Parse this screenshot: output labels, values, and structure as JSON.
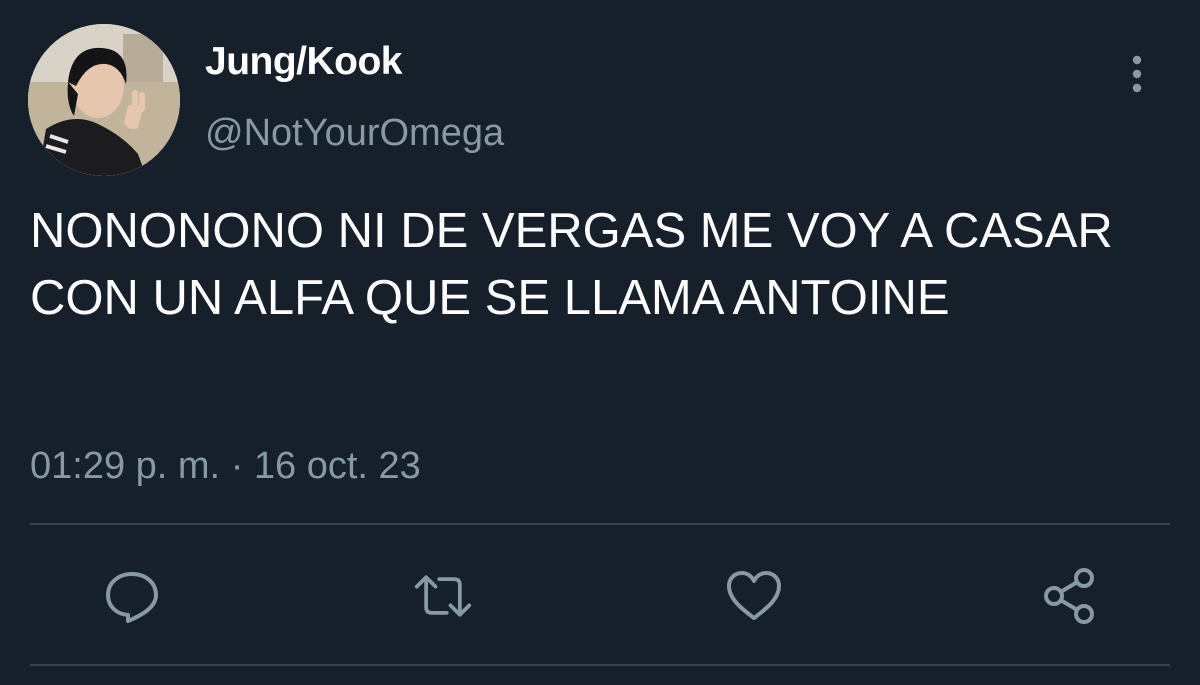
{
  "user": {
    "display_name": "Jung/Kook",
    "handle": "@NotYourOmega",
    "avatar_icon": "profile-photo"
  },
  "tweet": {
    "text": "NONONONO NI DE VERGAS ME VOY A CASAR CON UN ALFA QUE SE LLAMA ANTOINE",
    "time": "01:29 p. m.",
    "separator": "·",
    "date": "16 oct. 23"
  },
  "actions": [
    {
      "name": "reply",
      "icon": "comment-icon"
    },
    {
      "name": "retweet",
      "icon": "retweet-icon"
    },
    {
      "name": "like",
      "icon": "heart-icon"
    },
    {
      "name": "share",
      "icon": "share-icon"
    }
  ],
  "menu": {
    "icon": "more-vertical-icon"
  },
  "colors": {
    "background": "#15202b",
    "text_primary": "#ffffff",
    "text_secondary": "#8899a6",
    "icon": "#8899a6",
    "divider": "#38444d"
  }
}
